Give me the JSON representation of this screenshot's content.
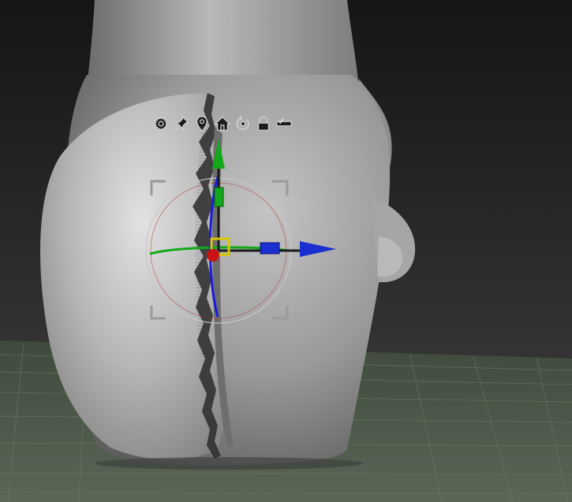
{
  "viewport": {
    "background_top": "#161616",
    "background_bottom": "#3a3a3a",
    "floor_color": "#4f5a4b",
    "floor_grid_color": "#6b7766",
    "mesh_color": "#9c9c9c",
    "mesh_highlight": "#d0d0d0"
  },
  "gizmo": {
    "axis_colors": {
      "x": "#1a2fd0",
      "y": "#12a81a",
      "z": "#1a1adf"
    },
    "pivot_color": "#c81414",
    "center_color": "#d8c800",
    "ring_color": "#c8c8c8",
    "toolbar": [
      {
        "name": "gear-icon",
        "icon": "gear"
      },
      {
        "name": "pin-icon",
        "icon": "pin"
      },
      {
        "name": "location-icon",
        "icon": "location-marker"
      },
      {
        "name": "home-icon",
        "icon": "home"
      },
      {
        "name": "reset-icon",
        "icon": "rotate-reset"
      },
      {
        "name": "lock-icon",
        "icon": "lock"
      },
      {
        "name": "toggle-icon",
        "icon": "checkbox-toggle"
      }
    ]
  }
}
